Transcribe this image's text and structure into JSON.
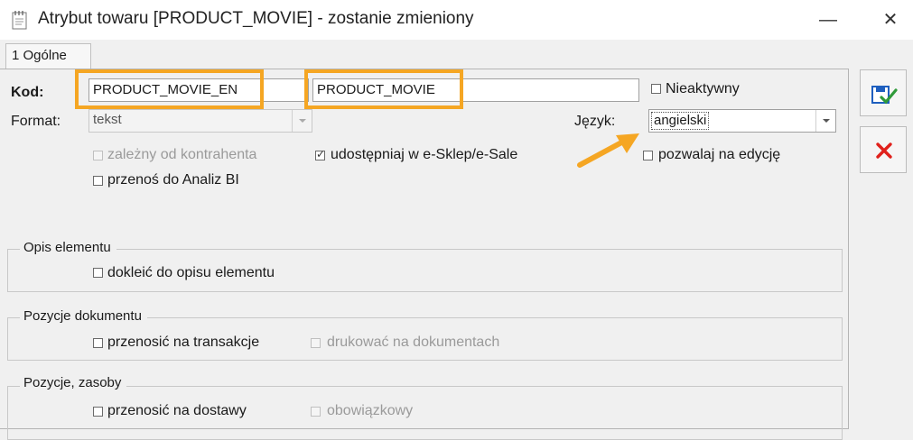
{
  "window": {
    "title": "Atrybut towaru [PRODUCT_MOVIE] - zostanie zmieniony",
    "minimize_label": "—",
    "close_label": "✕",
    "app_icon": "notepad-icon"
  },
  "tabs": [
    {
      "label": "1 Ogólne",
      "active": true
    }
  ],
  "form": {
    "kod_label": "Kod:",
    "kod_value": "PRODUCT_MOVIE_EN",
    "kod_value_2": "PRODUCT_MOVIE",
    "nieaktywny_label": "Nieaktywny",
    "format_label": "Format:",
    "format_value": "tekst",
    "jezyk_label": "Język:",
    "jezyk_value": "angielski",
    "zalezny_label": "zależny od kontrahenta",
    "udostepniaj_label": "udostępniaj w e-Sklep/e-Sale",
    "pozwalaj_label": "pozwalaj na edycję",
    "przenos_bi_label": "przenoś do Analiz BI"
  },
  "groups": {
    "opis": {
      "title": "Opis elementu",
      "doklej_label": "dokleić do opisu elementu"
    },
    "pozycje_dok": {
      "title": "Pozycje dokumentu",
      "transakcje_label": "przenosić na transakcje",
      "drukowac_label": "drukować na dokumentach"
    },
    "pozycje_zas": {
      "title": "Pozycje, zasoby",
      "dostawy_label": "przenosić na dostawy",
      "obowiazkowy_label": "obowiązkowy"
    }
  },
  "side_buttons": {
    "save_icon": "save-icon",
    "cancel_icon": "cancel-icon"
  },
  "colors": {
    "highlight": "#f5a623",
    "cancel_red": "#e0201b",
    "save_blue": "#1f5fbf"
  }
}
